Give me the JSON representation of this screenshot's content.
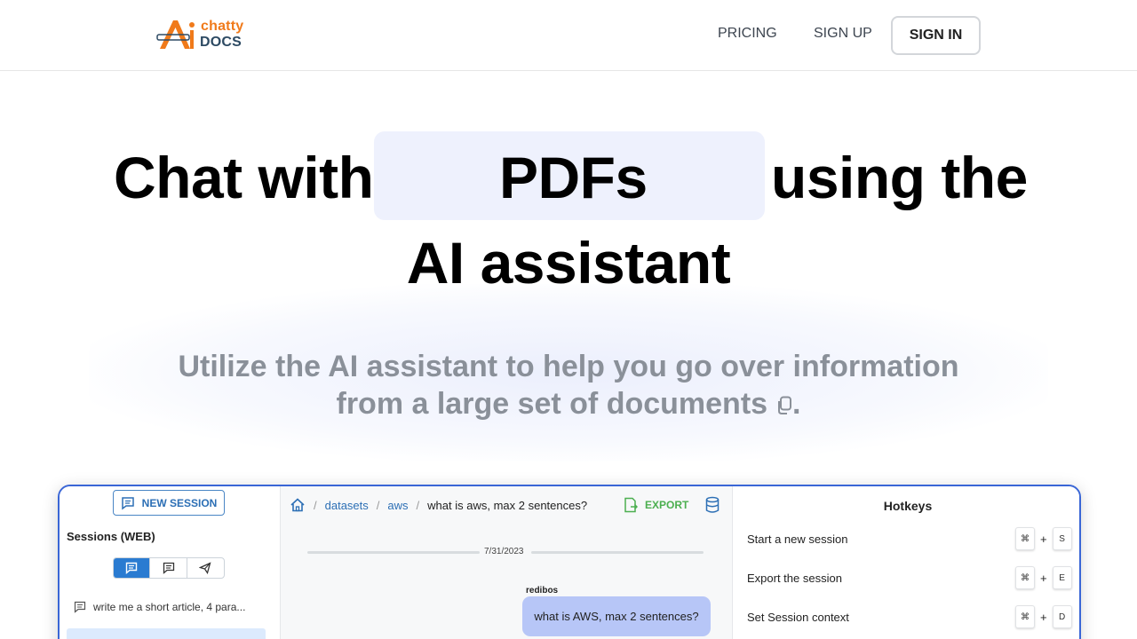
{
  "header": {
    "logo": {
      "line1": "chatty",
      "line2": "DOCS"
    },
    "nav": {
      "pricing": "PRICING",
      "signup": "SIGN UP",
      "signin": "SIGN IN"
    }
  },
  "hero": {
    "line1_prefix": "Chat with",
    "highlight": "PDFs",
    "line1_suffix": "using the",
    "line2": "AI assistant",
    "subtitle_line1": "Utilize the AI assistant to help you go over information",
    "subtitle_line2": "from a large set of documents",
    "subtitle_end": "."
  },
  "app_preview": {
    "sidebar": {
      "new_session_label": "NEW SESSION",
      "sessions_title": "Sessions (WEB)",
      "session_items": [
        "write me a short article, 4 para..."
      ]
    },
    "breadcrumb": [
      "datasets",
      "aws",
      "what is aws, max 2 sentences?"
    ],
    "export_label": "EXPORT",
    "chat": {
      "date": "7/31/2023",
      "user": "redibos",
      "message": "what is AWS, max 2 sentences?"
    },
    "hotkeys": {
      "title": "Hotkeys",
      "items": [
        {
          "label": "Start a new session",
          "mod": "⌘",
          "key": "S"
        },
        {
          "label": "Export the session",
          "mod": "⌘",
          "key": "E"
        },
        {
          "label": "Set Session context",
          "mod": "⌘",
          "key": "D"
        }
      ],
      "plus": "+"
    }
  },
  "colors": {
    "accent_orange": "#f07a1a",
    "link_blue": "#2c6fb5",
    "highlight_bg": "#eef1fd",
    "bubble": "#b7c6f7",
    "export_green": "#4caf50"
  }
}
